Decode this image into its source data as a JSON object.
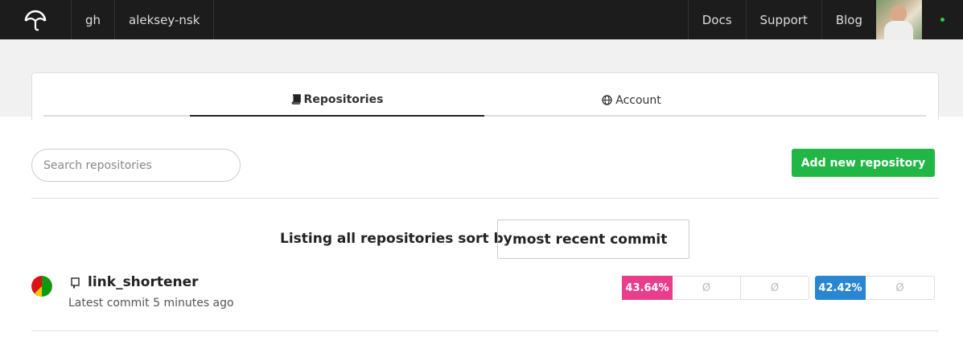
{
  "topbar": {
    "logo": "umbrella-logo",
    "breadcrumb": [
      "gh",
      "aleksey-nsk"
    ],
    "links": [
      "Docs",
      "Support",
      "Blog"
    ],
    "status_color": "#2ecc40"
  },
  "tabs": [
    {
      "label": "Repositories",
      "icon": "book-icon",
      "active": true
    },
    {
      "label": "Account",
      "icon": "globe-icon",
      "active": false
    }
  ],
  "search": {
    "placeholder": "Search repositories",
    "value": ""
  },
  "add_button": {
    "label": "Add new repository",
    "color": "#21b646"
  },
  "sort": {
    "label": "Listing all repositories sort by",
    "value": "most recent commit"
  },
  "repositories": [
    {
      "name": "link_shortener",
      "meta": "Latest commit 5 minutes ago",
      "icon": "repo-icon",
      "status_colors": [
        "#dd1111",
        "#119911",
        "#eecc11"
      ],
      "coverage": [
        {
          "value": "43.64%",
          "color": "#e83e8c"
        },
        {
          "value": "Ø",
          "color": ""
        },
        {
          "value": "Ø",
          "color": ""
        }
      ],
      "coverage2": [
        {
          "value": "42.42%",
          "color": "#2a86d1"
        },
        {
          "value": "Ø",
          "color": ""
        }
      ]
    }
  ]
}
